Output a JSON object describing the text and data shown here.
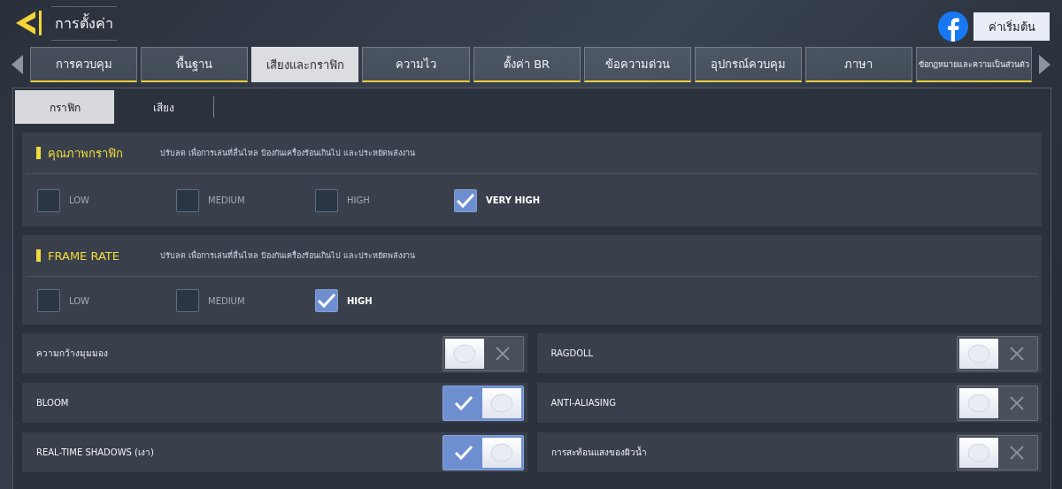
{
  "header": {
    "title": "การตั้งค่า",
    "reset_button": "ค่าเริ่มต้น"
  },
  "tabs": [
    {
      "label": "การควบคุม",
      "selected": false
    },
    {
      "label": "พื้นฐาน",
      "selected": false
    },
    {
      "label": "เสียงและกราฟิก",
      "selected": true
    },
    {
      "label": "ความไว",
      "selected": false
    },
    {
      "label": "ตั้งค่า BR",
      "selected": false
    },
    {
      "label": "ข้อความด่วน",
      "selected": false
    },
    {
      "label": "อุปกรณ์ควบคุม",
      "selected": false
    },
    {
      "label": "ภาษา",
      "selected": false
    },
    {
      "label": "ข้อกฎหมายและความเป็นส่วนตัว",
      "selected": false,
      "kind": "small"
    }
  ],
  "subtabs": [
    {
      "label": "กราฟิก",
      "selected": true
    },
    {
      "label": "เสียง",
      "selected": false
    }
  ],
  "sections": [
    {
      "title": "คุณภาพกราฟิก",
      "hint": "ปรับลด เพื่อการเล่นที่ลื่นไหล ป้องกันเครื่องร้อนเกินไป และประหยัดพลังงาน",
      "options": [
        {
          "label": "LOW",
          "checked": false
        },
        {
          "label": "MEDIUM",
          "checked": false
        },
        {
          "label": "HIGH",
          "checked": false
        },
        {
          "label": "VERY HIGH",
          "checked": true
        }
      ]
    },
    {
      "title": "FRAME RATE",
      "hint": "ปรับลด เพื่อการเล่นที่ลื่นไหล ป้องกันเครื่องร้อนเกินไป และประหยัดพลังงาน",
      "options": [
        {
          "label": "LOW",
          "checked": false
        },
        {
          "label": "MEDIUM",
          "checked": false
        },
        {
          "label": "HIGH",
          "checked": true
        }
      ]
    }
  ],
  "toggles": [
    {
      "label": "ความกว้างมุมมอง",
      "on": false
    },
    {
      "label": "RAGDOLL",
      "on": false
    },
    {
      "label": "BLOOM",
      "on": true
    },
    {
      "label": "ANTI-ALIASING",
      "on": false
    },
    {
      "label": "REAL-TIME SHADOWS (เงา)",
      "on": true
    },
    {
      "label": "การสะท้อนแสงของผิวน้ำ",
      "on": false
    }
  ]
}
